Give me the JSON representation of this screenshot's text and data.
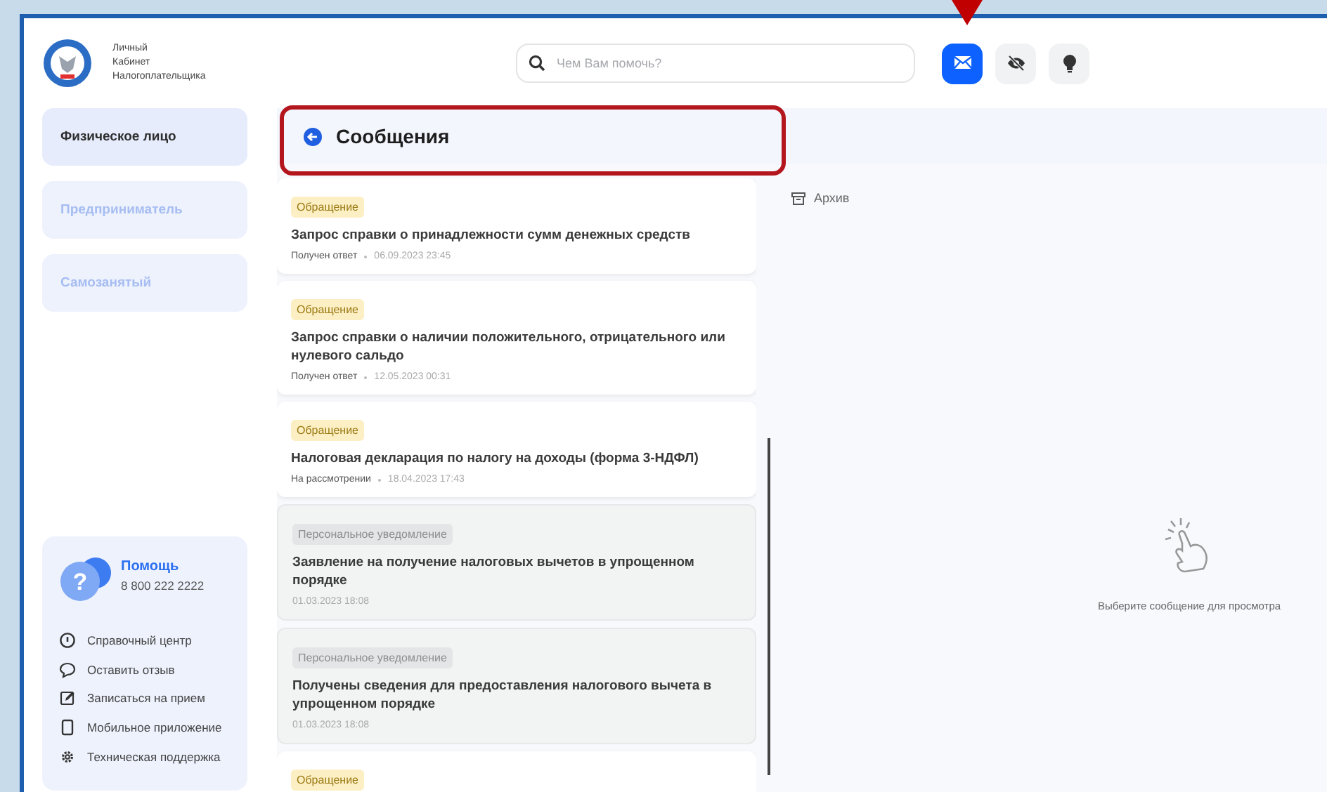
{
  "logo": {
    "lines": [
      "Личный",
      "Кабинет",
      "Налогоплательщика"
    ]
  },
  "search": {
    "placeholder": "Чем Вам помочь?"
  },
  "header_buttons": [
    {
      "kind": "mail",
      "selected": true
    },
    {
      "kind": "eye-off",
      "selected": false
    },
    {
      "kind": "bulb",
      "selected": false
    }
  ],
  "sidebar": {
    "items": [
      {
        "label": "Физическое лицо",
        "selected": true
      },
      {
        "label": "Предприниматель",
        "selected": false
      },
      {
        "label": "Самозанятый",
        "selected": false
      }
    ]
  },
  "help": {
    "badge": "?",
    "title": "Помощь",
    "phone": "8 800 222 2222",
    "links": [
      {
        "kind": "info",
        "label": "Справочный центр"
      },
      {
        "kind": "chat",
        "label": "Оставить отзыв"
      },
      {
        "kind": "edit",
        "label": "Записаться на прием"
      },
      {
        "kind": "phone",
        "label": "Мобильное приложение"
      },
      {
        "kind": "gear",
        "label": "Техническая поддержка"
      }
    ]
  },
  "messages": {
    "title": "Сообщения",
    "items": [
      {
        "kind": "appeal",
        "tag": "Обращение",
        "title": "Запрос справки о принадлежности сумм денежных средств",
        "status": "Получен ответ",
        "date": "06.09.2023 23:45"
      },
      {
        "kind": "appeal",
        "tag": "Обращение",
        "title": "Запрос справки о наличии положительного, отрицательного или нулевого сальдо",
        "status": "Получен ответ",
        "date": "12.05.2023 00:31"
      },
      {
        "kind": "appeal",
        "tag": "Обращение",
        "title": "Налоговая декларация по налогу на доходы (форма 3-НДФЛ)",
        "status": "На рассмотрении",
        "date": "18.04.2023 17:43"
      },
      {
        "kind": "notification",
        "tag": "Персональное уведомление",
        "title": "Заявление на получение налоговых вычетов в упрощенном порядке",
        "date": "01.03.2023 18:08"
      },
      {
        "kind": "notification",
        "tag": "Персональное уведомление",
        "title": "Получены сведения для предоставления налогового вычета в упрощенном порядке",
        "date": "01.03.2023 18:08"
      },
      {
        "kind": "appeal",
        "tag": "Обращение"
      }
    ]
  },
  "archive": {
    "label": "Архив"
  },
  "empty_state": {
    "text": "Выберите сообщение для просмотра"
  }
}
